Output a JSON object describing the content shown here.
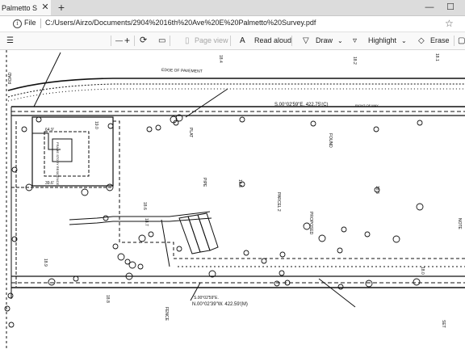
{
  "tab": {
    "title": "Palmetto Survey",
    "close_glyph": "✕"
  },
  "new_tab_glyph": "+",
  "window_controls": [
    "—",
    "☐"
  ],
  "address": {
    "scheme": "File",
    "url": "C:/Users/Airzo/Documents/2904%2016th%20Ave%20E%20Palmetto%20Survey.pdf",
    "star_glyph": "☆"
  },
  "toolbar": {
    "zoom_out": "—",
    "zoom_in": "+",
    "page_view": "Page view",
    "read_aloud": "Read aloud",
    "draw": "Draw",
    "highlight": "Highlight",
    "erase": "Erase"
  },
  "survey": {
    "edge_pavement": "EDGE OF PAVEMENT",
    "bearing_top": "S.00°02'59\"E.  422.75'(C)",
    "row_label": "RIGHT OF WAY",
    "bearing_bottom_1": "S.00°02'59\"E.",
    "bearing_bottom_2": "N.00°02'39\"W.  422.59'(M)",
    "parcel": "PARCEL 2",
    "house_label": "FRAME STORY RESIDENCE",
    "dim_top": "64.9'",
    "dim_bottom": "39.6'"
  }
}
